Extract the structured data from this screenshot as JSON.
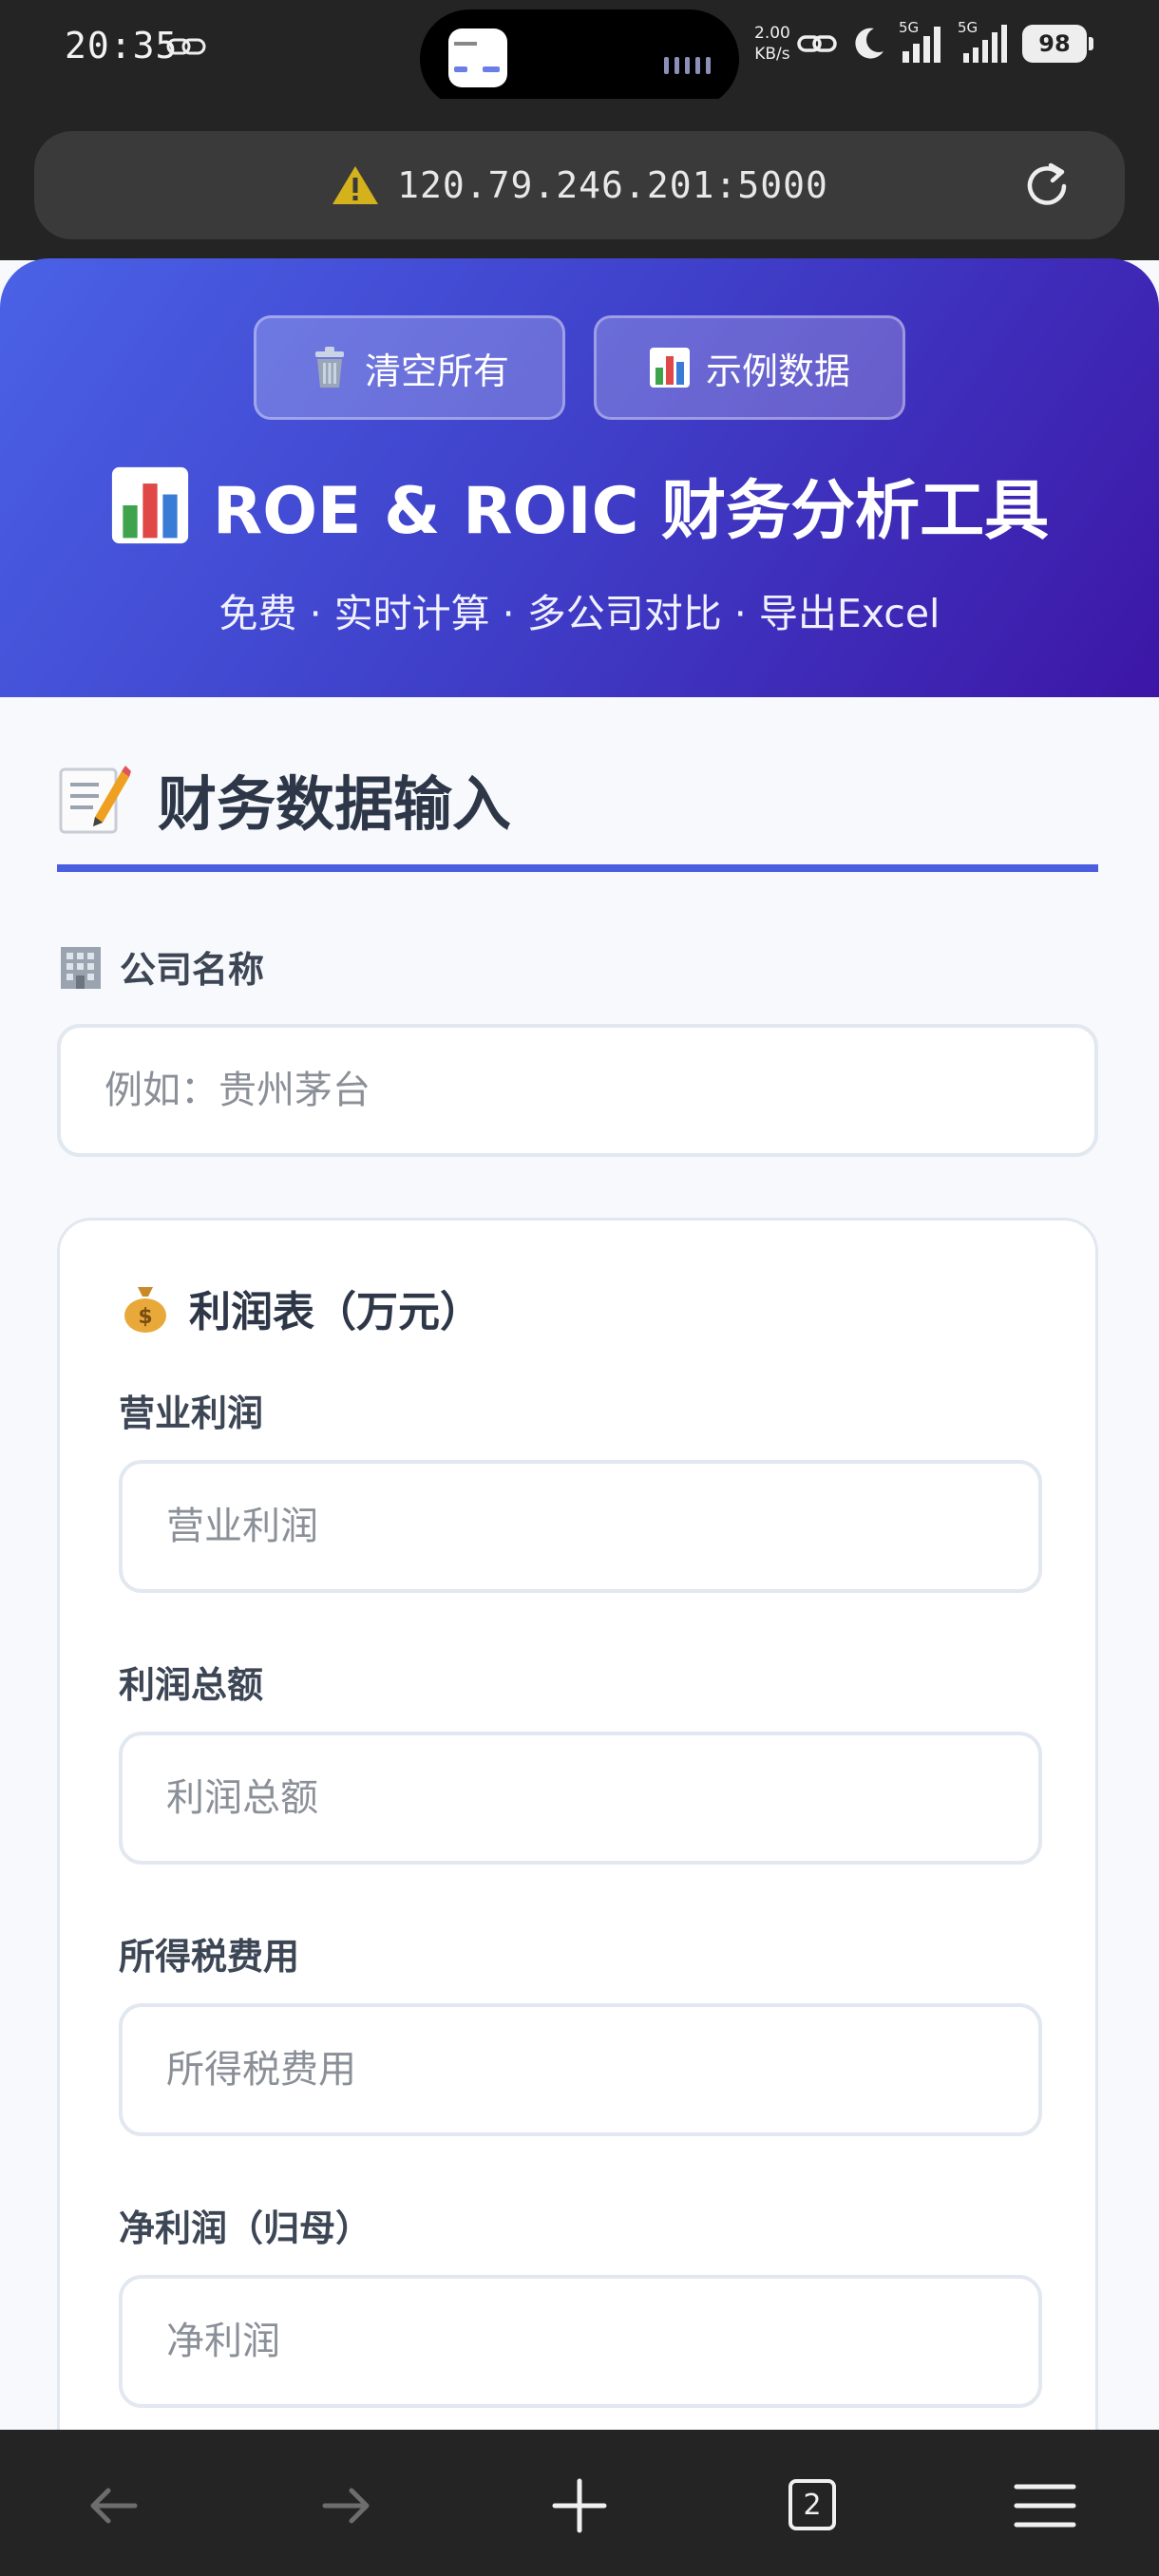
{
  "status_bar": {
    "time": "20:35",
    "net_speed_value": "2.00",
    "net_speed_unit": "KB/s",
    "network_1": "5G",
    "network_2": "5G",
    "battery": "98"
  },
  "browser": {
    "url": "120.79.246.201:5000",
    "tab_count": "2"
  },
  "header": {
    "clear_button": "清空所有",
    "sample_button": "示例数据",
    "title": "ROE & ROIC 财务分析工具",
    "subtitle": "免费 · 实时计算 · 多公司对比 · 导出Excel"
  },
  "form": {
    "section_title": "财务数据输入",
    "company_label": "公司名称",
    "company_placeholder": "例如：贵州茅台",
    "income_card_title": "利润表（万元）",
    "fields": [
      {
        "label": "营业利润",
        "placeholder": "营业利润"
      },
      {
        "label": "利润总额",
        "placeholder": "利润总额"
      },
      {
        "label": "所得税费用",
        "placeholder": "所得税费用"
      },
      {
        "label": "净利润（归母）",
        "placeholder": "净利润"
      }
    ]
  },
  "colors": {
    "hero_start": "#4a62e6",
    "hero_end": "#3d16a6",
    "accent_rule": "#4a5fe0",
    "warning": "#d4b21c"
  }
}
